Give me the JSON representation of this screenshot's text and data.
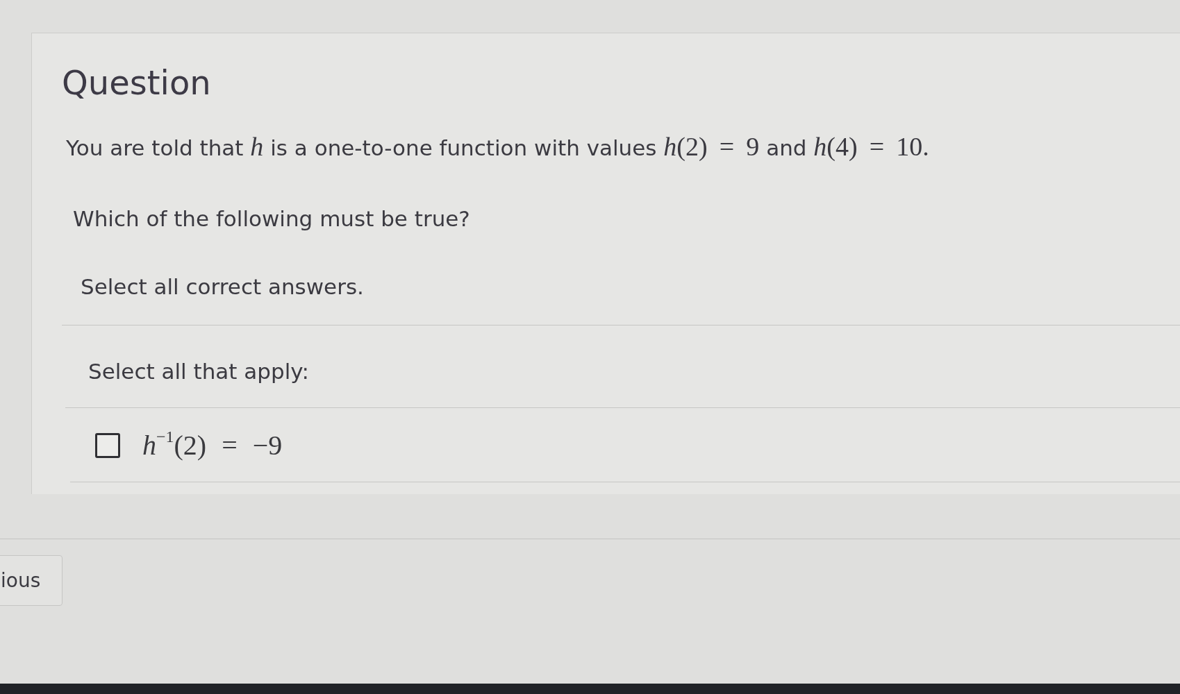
{
  "question": {
    "title": "Question",
    "prompt": [
      {
        "kind": "text",
        "text": "You are told that "
      },
      {
        "kind": "math",
        "text": "*h*"
      },
      {
        "kind": "text",
        "text": " is a one-to-one function with values "
      },
      {
        "kind": "math",
        "text": "*h*(2) = 9"
      },
      {
        "kind": "text",
        "text": " and "
      },
      {
        "kind": "math",
        "text": "*h*(4) = 10."
      }
    ],
    "instruction": "Which of the following must be true?",
    "note": "Select all correct answers."
  },
  "answers": {
    "heading": "Select all that apply:",
    "options": [
      {
        "checked": false,
        "label": "*h*$^{−1}$(2) = −9"
      }
    ]
  },
  "navigation": {
    "button": "ious"
  }
}
